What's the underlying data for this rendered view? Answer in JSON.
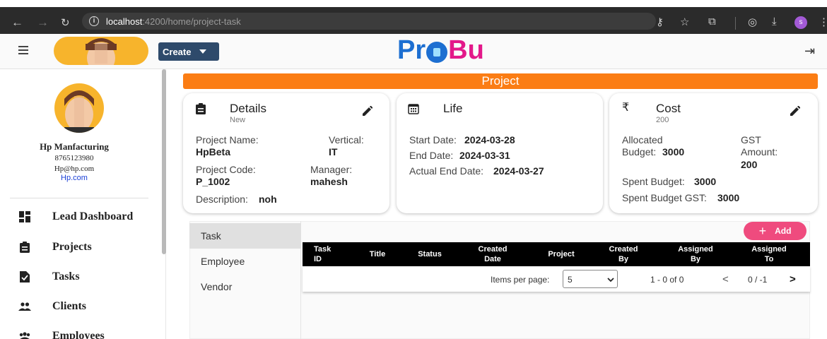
{
  "browser": {
    "url_host": "localhost",
    "url_path": ":4200/home/project-task",
    "profile_initial": "s"
  },
  "header": {
    "create_label": "Create",
    "logo_left": "Pr",
    "logo_right": "Bu"
  },
  "sidebar": {
    "company_name": "Hp Manfacturing",
    "phone": "8765123980",
    "email": "Hp@hp.com",
    "website": "Hp.com",
    "menu": [
      {
        "label": "Lead Dashboard",
        "icon": "dashboard-icon"
      },
      {
        "label": "Projects",
        "icon": "clipboard-icon"
      },
      {
        "label": "Tasks",
        "icon": "task-check-icon"
      },
      {
        "label": "Clients",
        "icon": "clients-icon"
      },
      {
        "label": "Employees",
        "icon": "employees-icon"
      }
    ]
  },
  "project": {
    "banner": "Project",
    "details": {
      "title": "Details",
      "subtitle": "New",
      "project_name_label": "Project Name:",
      "project_name": "HpBeta",
      "vertical_label": "Vertical:",
      "vertical": "IT",
      "project_code_label": "Project Code:",
      "project_code": "P_1002",
      "manager_label": "Manager:",
      "manager": "mahesh",
      "description_label": "Description:",
      "description": "noh"
    },
    "life": {
      "title": "Life",
      "start_label": "Start Date:",
      "start": "2024-03-28",
      "end_label": "End Date:",
      "end": "2024-03-31",
      "actual_end_label": "Actual End Date:",
      "actual_end": "2024-03-27"
    },
    "cost": {
      "title": "Cost",
      "currency_symbol": "₹",
      "subtitle": "200",
      "allocated_label_1": "Allocated",
      "allocated_label_2": "Budget:",
      "allocated": "3000",
      "gst_label_1": "GST",
      "gst_label_2": "Amount:",
      "gst": "200",
      "spent_label": "Spent Budget:",
      "spent": "3000",
      "spent_gst_label": "Spent Budget GST:",
      "spent_gst": "3000"
    }
  },
  "tabs": [
    {
      "label": "Task",
      "active": true
    },
    {
      "label": "Employee",
      "active": false
    },
    {
      "label": "Vendor",
      "active": false
    }
  ],
  "table": {
    "add_label": "Add",
    "columns": [
      {
        "l1": "Task",
        "l2": "ID"
      },
      {
        "l1": "Title",
        "l2": ""
      },
      {
        "l1": "Status",
        "l2": ""
      },
      {
        "l1": "Created",
        "l2": "Date"
      },
      {
        "l1": "Project",
        "l2": ""
      },
      {
        "l1": "Created",
        "l2": "By"
      },
      {
        "l1": "Assigned",
        "l2": "By"
      },
      {
        "l1": "Assigned",
        "l2": "To"
      }
    ],
    "items_per_page_label": "Items per page:",
    "items_per_page": "5",
    "range": "1 - 0 of 0",
    "page": "0 / -1"
  }
}
